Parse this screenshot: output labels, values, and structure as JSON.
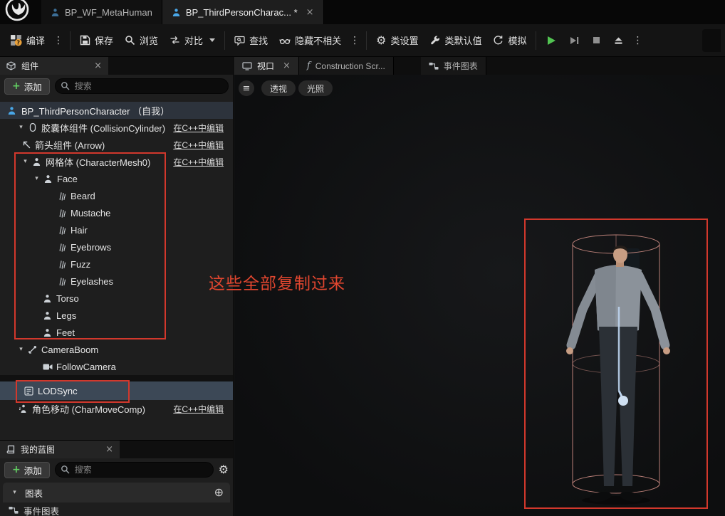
{
  "header": {
    "tabs": [
      {
        "label": "BP_WF_MetaHuman"
      },
      {
        "label": "BP_ThirdPersonCharac... *"
      }
    ]
  },
  "toolbar": {
    "compile": "编译",
    "save": "保存",
    "browse": "浏览",
    "diff": "对比",
    "find": "查找",
    "hide_unrelated": "隐藏不相关",
    "class_settings": "类设置",
    "class_defaults": "类默认值",
    "simulate": "模拟"
  },
  "components": {
    "tab": "组件",
    "add": "添加",
    "search_placeholder": "搜索",
    "root": "BP_ThirdPersonCharacter （自我）",
    "edit_in_cpp": "在C++中编辑",
    "tree": [
      {
        "label": "胶囊体组件 (CollisionCylinder)"
      },
      {
        "label": "箭头组件 (Arrow)"
      },
      {
        "label": "网格体 (CharacterMesh0)"
      },
      {
        "label": "Face"
      },
      {
        "label": "Beard"
      },
      {
        "label": "Mustache"
      },
      {
        "label": "Hair"
      },
      {
        "label": "Eyebrows"
      },
      {
        "label": "Fuzz"
      },
      {
        "label": "Eyelashes"
      },
      {
        "label": "Torso"
      },
      {
        "label": "Legs"
      },
      {
        "label": "Feet"
      },
      {
        "label": "CameraBoom"
      },
      {
        "label": "FollowCamera"
      },
      {
        "label": "LODSync"
      },
      {
        "label": "角色移动 (CharMoveComp)"
      }
    ]
  },
  "myblueprint": {
    "tab": "我的蓝图",
    "add": "添加",
    "search_placeholder": "搜索",
    "graphs_header": "图表",
    "event_graph": "事件图表"
  },
  "viewport": {
    "tab": "视口",
    "construction_tab": "Construction Scr...",
    "event_graph_tab": "事件图表",
    "perspective": "透视",
    "lit": "光照",
    "annotation": "这些全部复制过来"
  },
  "icons": {
    "expander": "▾",
    "dots": "⋮",
    "close": "×",
    "plus": "+",
    "gear": "⚙",
    "hamburger": "≡",
    "circle_plus": "⊕",
    "function_f": "f",
    "compile_badge": "?"
  },
  "colors": {
    "annotation_red": "#e0462f",
    "highlight_box_red": "#d2382c",
    "selection_row": "#3c4856",
    "play_green": "#52c452",
    "capsule_wireframe": "#d9938a"
  }
}
